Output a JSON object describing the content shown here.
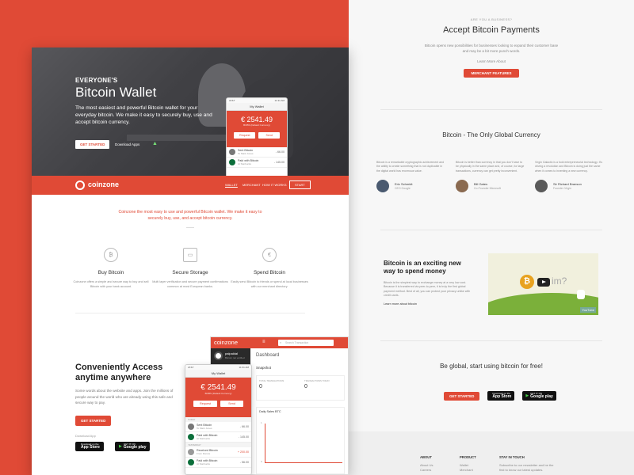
{
  "right": {
    "biz": {
      "eyebrow": "ARE YOU A BUSINESS?",
      "title": "Accept Bitcoin Payments",
      "desc": "Bitcoin opens new possibilities for businesses looking to expand their customer base and may be a bit more punch words.",
      "link": "Learn More About",
      "button": "MERCHANT FEATURES"
    },
    "global": {
      "title": "Bitcoin - The Only Global Currency",
      "quotes": [
        {
          "text": "Bitcoin is a remarkable cryptographic achievement and the ability to create something that is not duplicable in the digital world has enormous value.",
          "name": "Eric Schmidt",
          "role": "CEO Google"
        },
        {
          "text": "Bitcoin is better than currency in that you don't have to be physically in the same place and, of course, for large transactions, currency can get pretty inconvenient.",
          "name": "Bill Gates",
          "role": "Co-Founder Microsoft"
        },
        {
          "text": "Virgin Galactic is a bold entrepreneurial technology. It's driving a revolution and Bitcoin is doing just the same when it comes to inventing a new currency.",
          "name": "Sir Richard Branson",
          "role": "Founder Virgin"
        }
      ]
    },
    "exciting": {
      "title_line1": "Bitcoin is an exciting new",
      "title_line2": "way to spend money",
      "desc": "Bitcoin is the simplest way to exchange money at a very low cost. Because it is transferred via peer-to-peer, it is truly the first global payment method. Best of all, you can protect your privacy unlike with credit cards.",
      "link": "Learn more about bitcoin",
      "video_text": "im?",
      "video_brand": "YouTube"
    },
    "cta": {
      "title": "Be global, start using bitcoin for free!",
      "button": "GET STARTED",
      "appstore_small": "Download on the",
      "appstore": "App Store",
      "gplay_small": "GET IT ON",
      "gplay": "Google play"
    },
    "footer": {
      "cols": [
        {
          "title": "ABOUT",
          "items": [
            "About Us",
            "Careers"
          ]
        },
        {
          "title": "PRODUCT",
          "items": [
            "Wallet",
            "Merchant"
          ]
        },
        {
          "title": "STAY IN TOUCH",
          "items": [
            "Subscribe to our newsletter and be the",
            "first to know our latest updates."
          ]
        }
      ]
    }
  },
  "hero": {
    "eyebrow": "EVERYONE'S",
    "title": "Bitcoin Wallet",
    "desc": "The most easiest and powerful Bitcoin wallet for your everyday bitcoin. We make it easy to securely buy, use and accept bitcoin currency.",
    "button": "GET STARTED",
    "download": "Download Apps"
  },
  "phone1": {
    "status": "AT&T",
    "time": "11:31 AM",
    "title": "My Wallet",
    "balance": "€ 2541.49",
    "sub": "BOBS (Default Currency)",
    "request": "Request",
    "send": "Send",
    "txns": [
      {
        "name": "Sent Bitcoin",
        "who": "To Mark Jones",
        "amt": "- 66.00"
      },
      {
        "name": "Paid with Bitcoin",
        "who": "At Starbucks",
        "amt": "- 145.00"
      }
    ]
  },
  "nav": {
    "brand": "coinzone",
    "items": [
      "WALLET",
      "MERCHANT",
      "HOW IT WORKS"
    ],
    "start": "START"
  },
  "intro": {
    "text": "Coinzone the most easy to use and powerful Bitcoin wallet. We make it easy to securely buy, use, and accept bitcoin currency."
  },
  "features": [
    {
      "icon": "bitcoin-icon",
      "glyph": "₿",
      "title": "Buy Bitcoin",
      "desc": "Coinzone offers a simple and secure way to buy and sell Bitcoin with your bank account."
    },
    {
      "icon": "wallet-icon",
      "glyph": "▭",
      "title": "Secure Storage",
      "desc": "Multi layer verification and secure payment confirmations common at most European banks."
    },
    {
      "icon": "euro-icon",
      "glyph": "€",
      "title": "Spend Bitcoin",
      "desc": "Easily send Bitcoin to friends or spend at local businesses with our merchant directory."
    }
  ],
  "access": {
    "title_line1": "Conveniently Access",
    "title_line2": "anytime anywhere",
    "desc": "Some words about the website and apps. Join the millions of people around the world who are already using this safe and secure way to pay.",
    "button": "GET STARTED",
    "download": "Download App",
    "appstore_small": "Download on the",
    "appstore": "App Store",
    "gplay_small": "GET IT ON",
    "gplay": "Google play"
  },
  "dashboard": {
    "brand": "coinzone",
    "search": "Search Transaction",
    "user": "palpaldal",
    "user_status": "Bitcoin not verified",
    "title": "Dashboard",
    "snapshot": "Snapshot",
    "stat1_label": "TOTAL TRANSACTIONS",
    "stat1_value": "0",
    "stat2_label": "TRANSACTIONS TODAY",
    "stat2_value": "0",
    "chart_title": "Daily Sales BTC",
    "axis_top": "1",
    "axis_bottom": "0"
  },
  "phone2": {
    "status": "AT&T",
    "time": "11:31 AM",
    "title": "My Wallet",
    "balance": "€ 2541.49",
    "sub": "BOBS (Default Currency)",
    "request": "Request",
    "send": "Send",
    "section1": "TODAY",
    "section2": "YESTERDAY",
    "txns": [
      {
        "name": "Sent Bitcoin",
        "who": "To Mark Jones",
        "amt": "- 66.00"
      },
      {
        "name": "Paid with Bitcoin",
        "who": "At Starbucks",
        "amt": "- 145.00"
      },
      {
        "name": "Received Bitcoin",
        "who": "From Ronnie",
        "amt": "+ 200.00"
      },
      {
        "name": "Paid with Bitcoin",
        "who": "At Starbucks",
        "amt": "- 56.00"
      }
    ]
  },
  "colors": {
    "accent": "#e04a36",
    "dark": "#222222",
    "light": "#f7f7f7"
  }
}
